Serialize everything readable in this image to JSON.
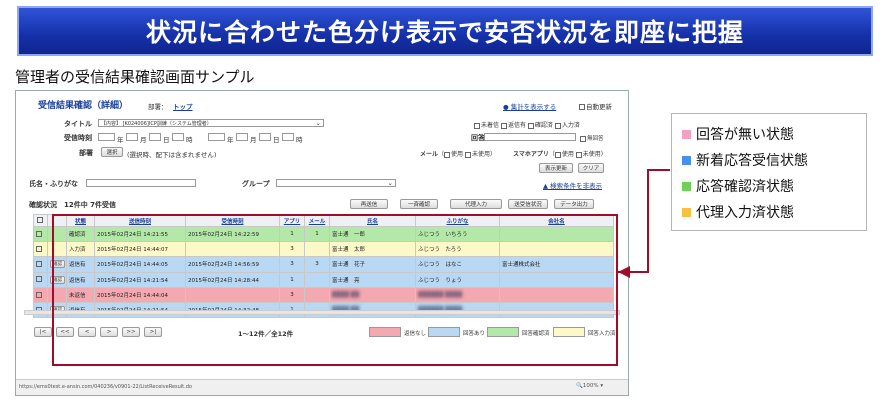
{
  "banner": {
    "title": "状況に合わせた色分け表示で安否状況を即座に把握"
  },
  "subtitle": "管理者の受信結果確認画面サンプル",
  "screen": {
    "page_title": "受信結果確認（詳細）",
    "dept_label": "部署：",
    "dept_link": "トップ",
    "summary_link": "集計を表示する",
    "auto_refresh": "自動更新",
    "title_label": "タイトル",
    "title_value": "【内容】 [K024006]ICP訓練（システム管理者）",
    "recv_time_label": "受信時刻",
    "year": "年",
    "month": "月",
    "day": "日",
    "hour": "時",
    "minute": "分",
    "answer_label": "回答",
    "no_answer": "無回答",
    "dept2_label": "部署",
    "select_btn": "選択",
    "dept2_note": "(選択時、配下は含まれません)",
    "mail_label": "メール",
    "app_label": "スマホアプリ",
    "used": "使用",
    "unused": "未使用",
    "filters": [
      "未着信",
      "返信有",
      "確認済",
      "入力済"
    ],
    "show_btn": "表示更新",
    "clear_btn": "クリア",
    "name_label": "氏名・ふりがな",
    "group_label": "グループ",
    "search_toggle": "▲ 検索条件を非表示",
    "status_title": "確認状況",
    "status_count": "12件中 7件受信",
    "actions": [
      "再送信",
      "一斉確認",
      "代理入力",
      "送受信状況",
      "データ出力"
    ],
    "columns": [
      "",
      "",
      "状態",
      "送信時刻",
      "受信時刻",
      "アプリ",
      "メール",
      "氏名",
      "ふりがな",
      "会社名"
    ],
    "rows": [
      {
        "type": "g",
        "btn": "",
        "state": "確認済",
        "sent": "2015年02月24日 14:21:55",
        "recv": "2015年02月24日 14:22:59",
        "app": "1",
        "mail": "1",
        "name": "富士通　一郎",
        "kana": "ふじつう　いちろう",
        "company": ""
      },
      {
        "type": "y",
        "btn": "",
        "state": "入力済",
        "sent": "2015年02月24日 14:44:07",
        "recv": "",
        "app": "3",
        "mail": "",
        "name": "富士通　太郎",
        "kana": "ふじつう　たろう",
        "company": ""
      },
      {
        "type": "b",
        "btn": "確認",
        "state": "返信有",
        "sent": "2015年02月24日 14:44:05",
        "recv": "2015年02月24日 14:56:59",
        "app": "3",
        "mail": "3",
        "name": "富士通　花子",
        "kana": "ふじつう　はなこ",
        "company": "富士通株式会社"
      },
      {
        "type": "b",
        "btn": "確認",
        "state": "返信有",
        "sent": "2015年02月24日 14:21:54",
        "recv": "2015年02月24日 14:28:44",
        "app": "1",
        "mail": "",
        "name": "富士通　亮",
        "kana": "ふじつう　りょう",
        "company": ""
      },
      {
        "type": "r",
        "btn": "",
        "state": "未返信",
        "sent": "2015年02月24日 14:44:04",
        "recv": "",
        "app": "3",
        "mail": "",
        "name": "",
        "kana": "",
        "company": ""
      },
      {
        "type": "b",
        "btn": "確認",
        "state": "返信有",
        "sent": "2015年02月24日 14:21:54",
        "recv": "2015年02月24日 14:32:48",
        "app": "1",
        "mail": "",
        "name": "",
        "kana": "",
        "company": ""
      }
    ],
    "pager": "1～12件／全12件",
    "pager_btns": [
      "|<",
      "<<",
      "<",
      ">",
      ">>",
      ">|"
    ],
    "legend_small": [
      "返信なし",
      "回答あり",
      "回答確認済",
      "回答入力済"
    ],
    "url": "https://ems0test.e-ansin.com/040236/v0901-22/ListReceiveResult.do",
    "zoom": "100%"
  },
  "legend": {
    "items": [
      {
        "label": "回答が無い状態",
        "color": "#f4a0c0"
      },
      {
        "label": "新着応答受信状態",
        "color": "#4a8ef0"
      },
      {
        "label": "応答確認済状態",
        "color": "#6fd05a"
      },
      {
        "label": "代理入力済状態",
        "color": "#f8c040"
      }
    ]
  }
}
